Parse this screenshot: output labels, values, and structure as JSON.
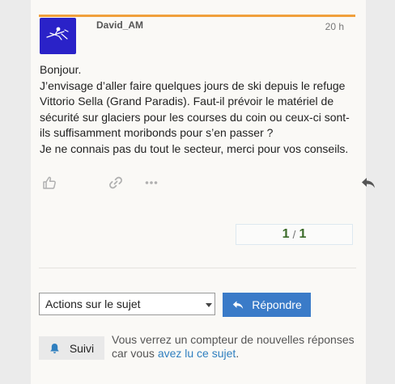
{
  "post": {
    "username": "David_AM",
    "date": "20 h",
    "body_lines": [
      "Bonjour.",
      "J’envisage d’aller faire quelques jours de ski depuis le refuge Vittorio Sella (Grand Paradis). Faut-il prévoir le matériel de sécurité sur glaciers pour les courses du coin ou ceux-ci sont-ils suffisamment moribonds pour s’en passer ?",
      "Je ne connais pas du tout le secteur, merci pour vos conseils."
    ],
    "action_icons": [
      "like-icon",
      "link-icon",
      "more-icon",
      "reply-icon"
    ]
  },
  "progress": {
    "current": "1",
    "total": "1",
    "separator": "/"
  },
  "footer": {
    "topic_actions_label": "Actions sur le sujet",
    "reply_label": "Répondre",
    "follow_label": "Suivi",
    "follow_note_text": "Vous verrez un compteur de nouvelles réponses car vous ",
    "follow_note_link": "avez lu ce sujet",
    "follow_note_end": "."
  },
  "colors": {
    "accent_bar": "#f0a03c",
    "avatar_bg": "#2a22c8",
    "primary_button": "#3a7bc8",
    "progress_text": "#3b6b29",
    "link": "#2f7fbf"
  }
}
